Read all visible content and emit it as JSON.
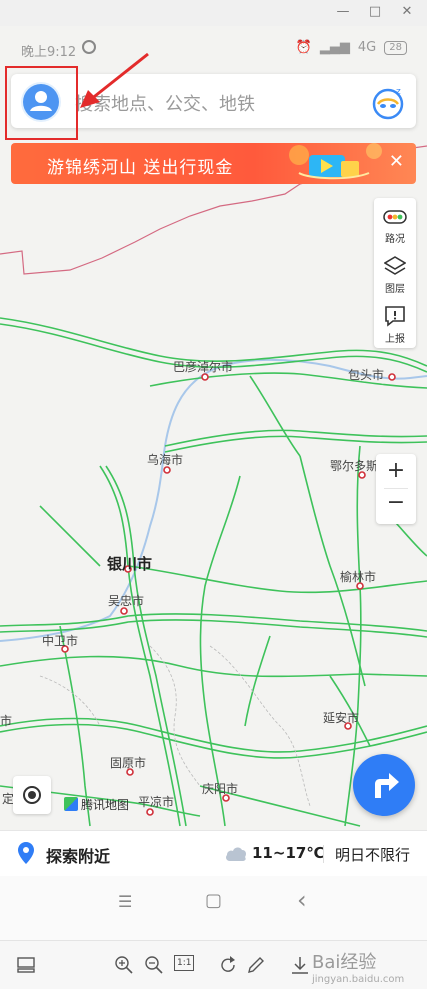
{
  "status_bar": {
    "time": "晚上9:12",
    "network": "4G",
    "battery": "28"
  },
  "search": {
    "placeholder": "搜索地点、公交、地铁"
  },
  "promo": {
    "text": "游锦绣河山  送出行现金",
    "close": "✕"
  },
  "tools": [
    {
      "label": "路况",
      "icon": "traffic-icon"
    },
    {
      "label": "图层",
      "icon": "layers-icon"
    },
    {
      "label": "上报",
      "icon": "report-icon"
    }
  ],
  "zoom": {
    "in": "+",
    "out": "−"
  },
  "map": {
    "cities": [
      {
        "name": "巴彦淖尔市"
      },
      {
        "name": "包头市"
      },
      {
        "name": "乌海市"
      },
      {
        "name": "鄂尔多斯"
      },
      {
        "name": "银川市"
      },
      {
        "name": "榆林市"
      },
      {
        "name": "吴忠市"
      },
      {
        "name": "中卫市"
      },
      {
        "name": "延安市"
      },
      {
        "name": "固原市"
      },
      {
        "name": "庆阳市"
      },
      {
        "name": "平凉市"
      },
      {
        "name": "市"
      },
      {
        "name": "定"
      }
    ],
    "brand": "腾讯地图"
  },
  "bottom": {
    "explore": "探索附近",
    "weather": "11~17℃",
    "restriction": "明日不限行"
  },
  "sys_nav": {
    "menu": "☰",
    "home": "▢",
    "back": "‹"
  },
  "viewer": {
    "zoom_level": "1:1"
  },
  "watermark": {
    "main": "Bai经验",
    "sub": "jingyan.baidu.com"
  },
  "colors": {
    "accent": "#2f7df6",
    "promo": "#ff5a3c",
    "highway": "#3ec25b",
    "border": "#d46a82",
    "annotation": "#e32b2b"
  }
}
